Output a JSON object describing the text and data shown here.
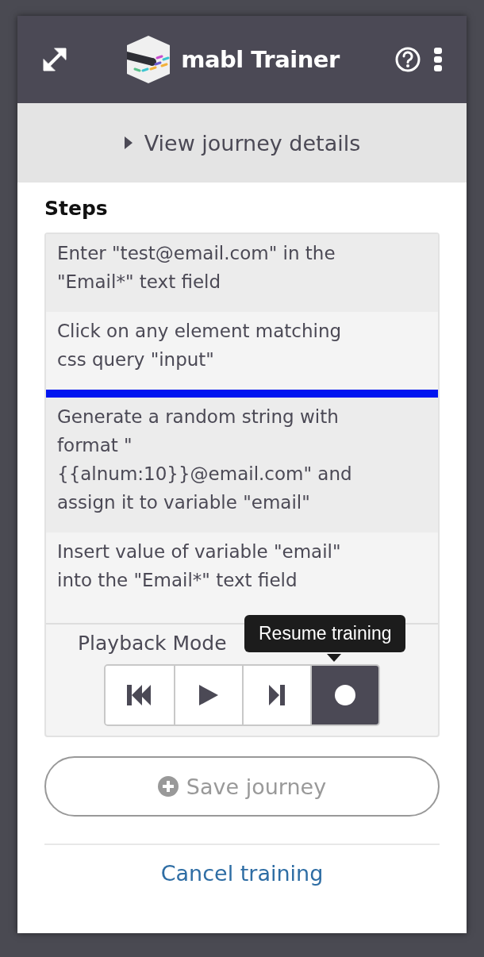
{
  "header": {
    "title": "mabl Trainer"
  },
  "journey_details": {
    "label": "View journey details",
    "expanded": false
  },
  "steps": {
    "heading": "Steps",
    "items": [
      {
        "text": "Enter \"test@email.com\" in the \"Email*\" text field",
        "insertion_point_after": false
      },
      {
        "text": "Click on any element matching css query \"input\"",
        "insertion_point_after": true
      },
      {
        "text": "Generate a random string with format \"{{alnum:10}}@email.com\" and assign it to variable \"email\"",
        "insertion_point_after": false
      },
      {
        "text": "Insert value of variable \"email\" into the \"Email*\" text field",
        "insertion_point_after": false
      }
    ]
  },
  "playback": {
    "label": "Playback Mode",
    "controls": [
      {
        "kind": "restart",
        "selected": false
      },
      {
        "kind": "play",
        "selected": false
      },
      {
        "kind": "step",
        "selected": false
      },
      {
        "kind": "record",
        "selected": true
      }
    ],
    "tooltip": "Resume training"
  },
  "save_button": {
    "label": "Save journey",
    "disabled": true
  },
  "cancel_link": "Cancel training"
}
